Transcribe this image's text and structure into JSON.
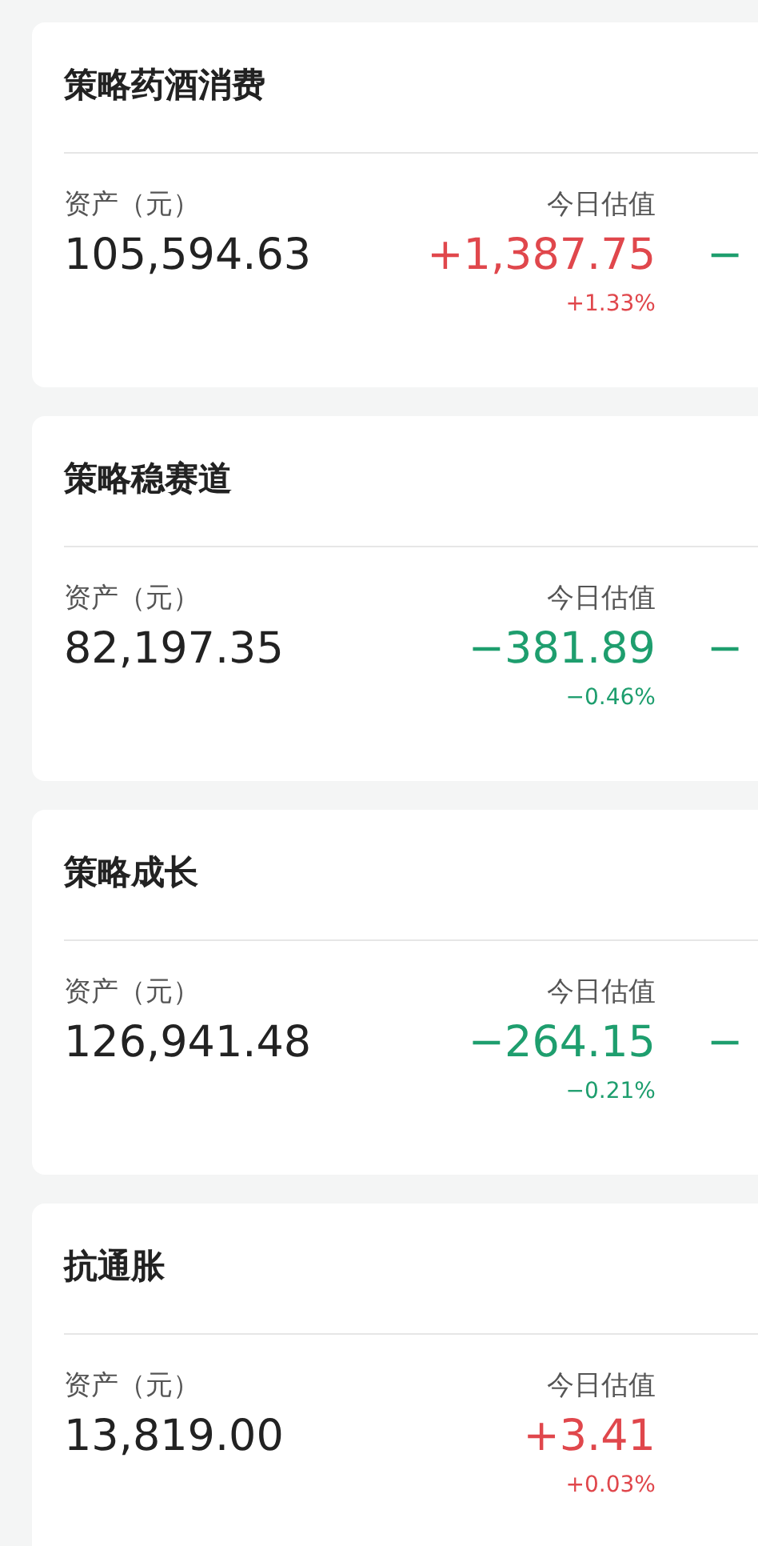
{
  "funds": [
    {
      "name": "策略药酒消费",
      "asset_label": "资产（元）",
      "asset": "105,594.63",
      "estimate_label": "今日估值",
      "kind": "gain",
      "change": "+1,387.75",
      "change_pct": "+1.33%",
      "column_3": {
        "text": "−",
        "kind": "loss"
      }
    },
    {
      "name": "策略稳赛道",
      "asset_label": "资产（元）",
      "asset": "82,197.35",
      "estimate_label": "今日估值",
      "kind": "loss",
      "change": "−381.89",
      "change_pct": "−0.46%",
      "column_3": {
        "text": "−",
        "kind": "loss"
      }
    },
    {
      "name": "策略成长",
      "asset_label": "资产（元）",
      "asset": "126,941.48",
      "estimate_label": "今日估值",
      "kind": "loss",
      "change": "−264.15",
      "change_pct": "−0.21%",
      "column_3": {
        "text": "−",
        "kind": "loss"
      }
    },
    {
      "name": "抗通胀",
      "asset_label": "资产（元）",
      "asset": "13,819.00",
      "estimate_label": "今日估值",
      "kind": "gain",
      "change": "+3.41",
      "change_pct": "+0.03%"
    }
  ]
}
